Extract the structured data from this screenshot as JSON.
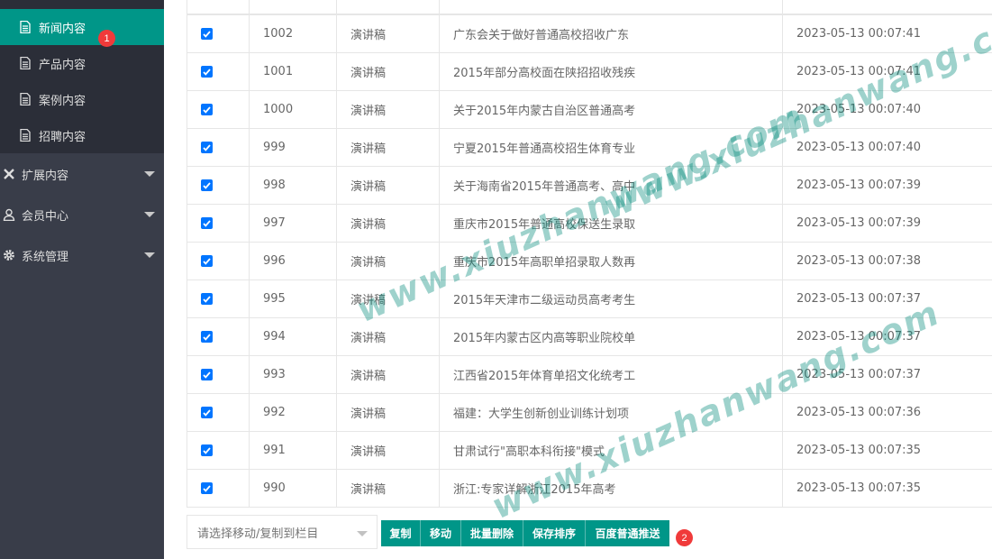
{
  "sidebar": {
    "sub_items": [
      {
        "label": "新闻内容",
        "active": true
      },
      {
        "label": "产品内容",
        "active": false
      },
      {
        "label": "案例内容",
        "active": false
      },
      {
        "label": "招聘内容",
        "active": false
      }
    ],
    "menu_items": [
      {
        "label": "扩展内容",
        "icon": "puzzle-icon"
      },
      {
        "label": "会员中心",
        "icon": "user-icon"
      },
      {
        "label": "系统管理",
        "icon": "gear-icon"
      }
    ],
    "badge_1": "1"
  },
  "table": {
    "rows": [
      {
        "checked": true,
        "id": "1002",
        "type": "演讲稿",
        "title": "广东会关于做好普通高校招收广东",
        "date": "2023-05-13 00:07:41"
      },
      {
        "checked": true,
        "id": "1001",
        "type": "演讲稿",
        "title": "2015年部分高校面在陕招招收残疾",
        "date": "2023-05-13 00:07:41"
      },
      {
        "checked": true,
        "id": "1000",
        "type": "演讲稿",
        "title": "关于2015年内蒙古自治区普通高考",
        "date": "2023-05-13 00:07:40"
      },
      {
        "checked": true,
        "id": "999",
        "type": "演讲稿",
        "title": "宁夏2015年普通高校招生体育专业",
        "date": "2023-05-13 00:07:40"
      },
      {
        "checked": true,
        "id": "998",
        "type": "演讲稿",
        "title": "关于海南省2015年普通高考、高中",
        "date": "2023-05-13 00:07:39"
      },
      {
        "checked": true,
        "id": "997",
        "type": "演讲稿",
        "title": "重庆市2015年普通高校保送生录取",
        "date": "2023-05-13 00:07:39"
      },
      {
        "checked": true,
        "id": "996",
        "type": "演讲稿",
        "title": "重庆市2015年高职单招录取人数再",
        "date": "2023-05-13 00:07:38"
      },
      {
        "checked": true,
        "id": "995",
        "type": "演讲稿",
        "title": "2015年天津市二级运动员高考考生",
        "date": "2023-05-13 00:07:37"
      },
      {
        "checked": true,
        "id": "994",
        "type": "演讲稿",
        "title": "2015年内蒙古区内高等职业院校单",
        "date": "2023-05-13 00:07:37"
      },
      {
        "checked": true,
        "id": "993",
        "type": "演讲稿",
        "title": "江西省2015年体育单招文化统考工",
        "date": "2023-05-13 00:07:37"
      },
      {
        "checked": true,
        "id": "992",
        "type": "演讲稿",
        "title": "福建：大学生创新创业训练计划项",
        "date": "2023-05-13 00:07:36"
      },
      {
        "checked": true,
        "id": "991",
        "type": "演讲稿",
        "title": "甘肃试行\"高职本科衔接\"模式",
        "date": "2023-05-13 00:07:35"
      },
      {
        "checked": true,
        "id": "990",
        "type": "演讲稿",
        "title": "浙江:专家详解浙江2015年高考",
        "date": "2023-05-13 00:07:35"
      }
    ]
  },
  "bottom": {
    "select_placeholder": "请选择移动/复制到栏目",
    "buttons": [
      "复制",
      "移动",
      "批量删除",
      "保存排序",
      "百度普通推送"
    ],
    "badge_2": "2"
  },
  "watermark": [
    "www.xiuzhanwang.com",
    "www.xiuzhanwang.com",
    "www.xiuzhanwang.com"
  ],
  "colors": {
    "accent": "#009688",
    "sidebar": "#393d49",
    "submenu": "#2b2e38",
    "badge": "#f03a3a",
    "checkbox": "#0075ff"
  }
}
